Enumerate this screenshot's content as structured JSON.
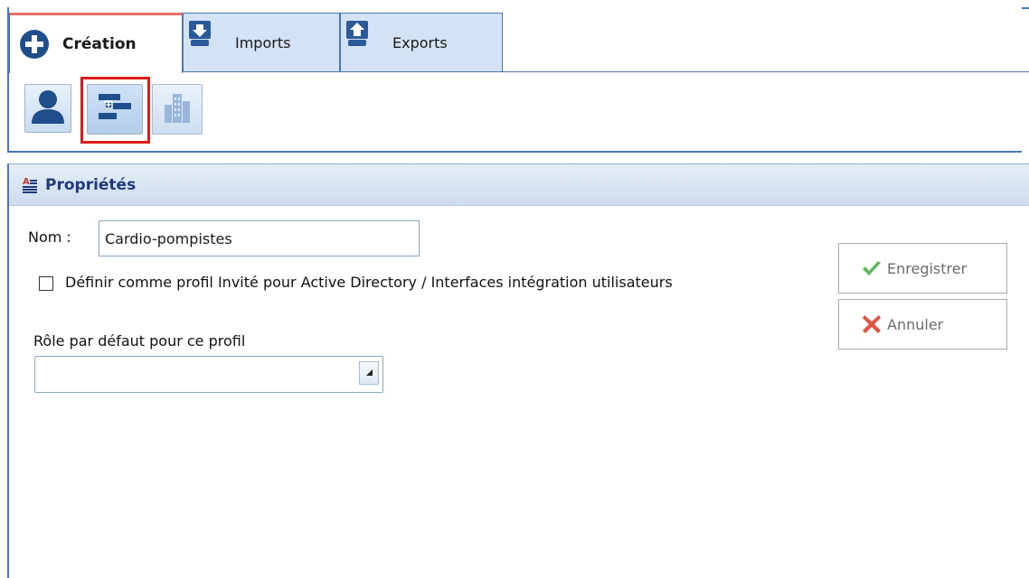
{
  "tabs": [
    {
      "label": "Création",
      "icon": "add-circle-icon",
      "active": true
    },
    {
      "label": "Imports",
      "icon": "import-icon",
      "active": false
    },
    {
      "label": "Exports",
      "icon": "export-icon",
      "active": false
    }
  ],
  "toolbar": {
    "buttons": [
      {
        "icon": "user-icon",
        "enabled": true,
        "selected": false
      },
      {
        "icon": "structure-icon",
        "enabled": true,
        "selected": true
      },
      {
        "icon": "building-icon",
        "enabled": false,
        "selected": false
      }
    ]
  },
  "panel": {
    "title": "Propriétés",
    "name_label": "Nom :",
    "name_value": "Cardio-pompistes",
    "guest_checkbox_label": "Définir comme profil Invité pour Active Directory / Interfaces intégration utilisateurs",
    "guest_checked": false,
    "role_label": "Rôle par défaut pour ce profil",
    "role_value": "",
    "save_label": "Enregistrer",
    "cancel_label": "Annuler"
  },
  "colors": {
    "accent": "#4a78b5",
    "active_tab_top": "#e46f62",
    "selection_frame": "#e01b1b",
    "save_check": "#5cb85c",
    "cancel_x": "#e0533f"
  }
}
